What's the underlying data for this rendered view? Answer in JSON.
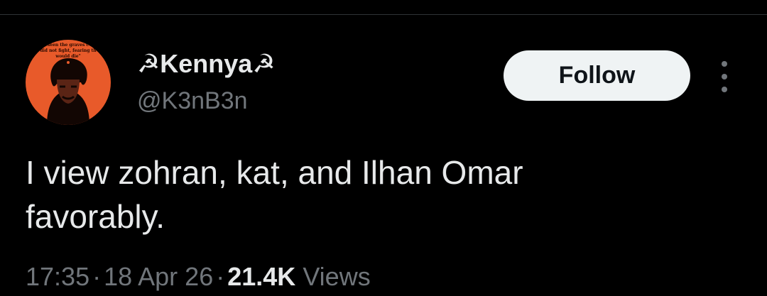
{
  "author": {
    "display_name": "☭Kennya☭",
    "handle": "@K3nB3n",
    "avatar_caption": [
      "seen the graves c",
      "did not fight, fearing th",
      "would die\""
    ]
  },
  "follow_button": {
    "label": "Follow"
  },
  "more_button": {
    "icon": "more-vertical-icon"
  },
  "tweet": {
    "text": "I view zohran, kat, and Ilhan Omar\nfavorably."
  },
  "meta": {
    "time": "17:35",
    "date": "18 Apr 26",
    "separator": "·",
    "views_count": "21.4K",
    "views_label": "Views"
  },
  "colors": {
    "background": "#000000",
    "primary_text": "#e7e9ea",
    "secondary_text": "#71767b",
    "follow_button_bg": "#eff3f4",
    "avatar_bg": "#e85a2a"
  }
}
